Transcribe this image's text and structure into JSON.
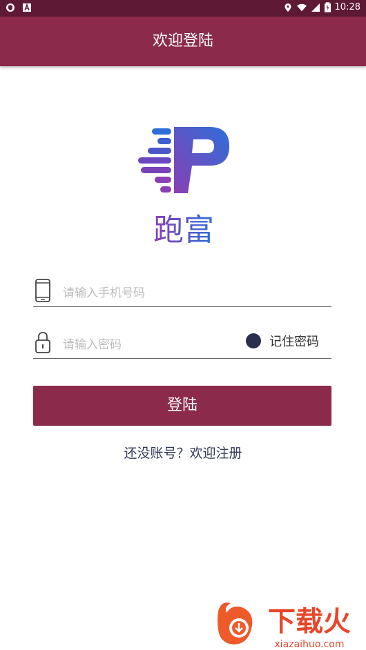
{
  "status_bar": {
    "time": "10:28",
    "icons": [
      "shield-icon",
      "a-icon",
      "location-icon",
      "wifi-icon",
      "signal-icon",
      "battery-icon"
    ]
  },
  "app_bar": {
    "title": "欢迎登陆"
  },
  "logo": {
    "brand": "跑富",
    "letter": "P"
  },
  "phone_field": {
    "placeholder": "请输入手机号码",
    "icon": "phone-icon"
  },
  "password_field": {
    "placeholder": "请输入密码",
    "icon": "lock-icon"
  },
  "remember_password": {
    "label": "记住密码",
    "checked": true
  },
  "login_button": {
    "label": "登陆"
  },
  "register_link": {
    "label": "还没账号？欢迎注册"
  },
  "watermark": {
    "text": "下载火",
    "url_text": "xiazaihuo.com"
  },
  "colors": {
    "primary": "#8b2a4a",
    "status_bar": "#5e1a34",
    "logo_blue": "#2d6fd9",
    "logo_purple": "#8a3fb4",
    "dot": "#2b2f4f"
  }
}
